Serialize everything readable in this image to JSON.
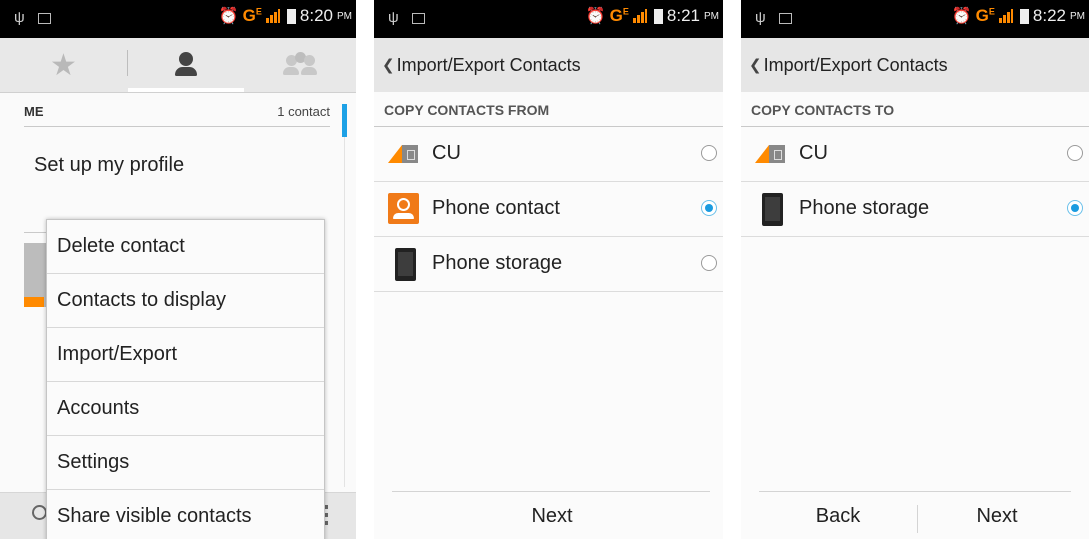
{
  "screen1": {
    "status": {
      "time": "8:20",
      "ampm": "PM",
      "network": "G",
      "network_sup": "E"
    },
    "tabs": [
      {
        "name": "favorites",
        "icon": "star-icon"
      },
      {
        "name": "contacts",
        "icon": "person-icon",
        "selected": true
      },
      {
        "name": "groups",
        "icon": "group-icon"
      }
    ],
    "me_header": {
      "title": "ME",
      "count": "1 contact"
    },
    "profile_text": "Set up my profile",
    "menu": {
      "items": [
        "Delete contact",
        "Contacts to display",
        "Import/Export",
        "Accounts",
        "Settings",
        "Share visible contacts"
      ]
    }
  },
  "screen2": {
    "status": {
      "time": "8:21",
      "ampm": "PM",
      "network": "G",
      "network_sup": "E"
    },
    "title": "Import/Export Contacts",
    "section": "COPY CONTACTS FROM",
    "options": [
      {
        "label": "CU",
        "icon": "sim-card-icon",
        "selected": false
      },
      {
        "label": "Phone contact",
        "icon": "contact-icon",
        "selected": true
      },
      {
        "label": "Phone storage",
        "icon": "phone-icon",
        "selected": false
      }
    ],
    "next_label": "Next"
  },
  "screen3": {
    "status": {
      "time": "8:22",
      "ampm": "PM",
      "network": "G",
      "network_sup": "E"
    },
    "title": "Import/Export Contacts",
    "section": "COPY CONTACTS TO",
    "options": [
      {
        "label": "CU",
        "icon": "sim-card-icon",
        "selected": false
      },
      {
        "label": "Phone storage",
        "icon": "phone-icon",
        "selected": true
      }
    ],
    "back_label": "Back",
    "next_label": "Next"
  },
  "colors": {
    "accent": "#1a9be0",
    "orange": "#ff8a00",
    "statusbar": "#000000"
  }
}
